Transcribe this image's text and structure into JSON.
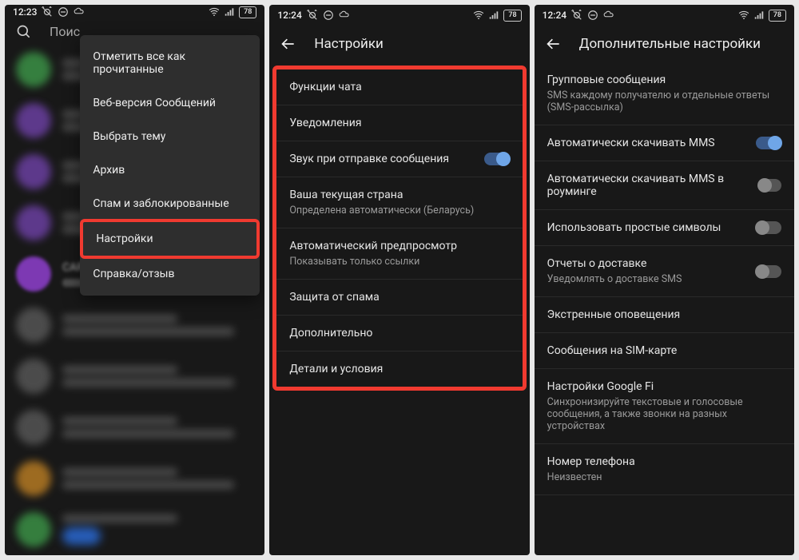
{
  "status": {
    "time1": "12:23",
    "time2": "12:24",
    "time3": "12:24",
    "battery": "78"
  },
  "phone1": {
    "search_placeholder": "Поис",
    "menu": {
      "mark_all_read": "Отметить все как прочитанные",
      "web_version": "Веб-версия Сообщений",
      "choose_theme": "Выбрать тему",
      "archive": "Архив",
      "spam_blocked": "Спам и заблокированные",
      "settings": "Настройки",
      "help_feedback": "Справка/отзыв"
    },
    "chat_label": "CAR"
  },
  "phone2": {
    "title": "Настройки",
    "items": {
      "chat_features": "Функции чата",
      "notifications": "Уведомления",
      "send_sound": "Звук при отправке сообщения",
      "country_title": "Ваша текущая страна",
      "country_sub": "Определена автоматически (Беларусь)",
      "preview_title": "Автоматический предпросмотр",
      "preview_sub": "Показывать только ссылки",
      "spam_protect": "Защита от спама",
      "advanced": "Дополнительно",
      "details": "Детали и условия"
    }
  },
  "phone3": {
    "title": "Дополнительные настройки",
    "group_title": "Групповые сообщения",
    "group_sub": "SMS каждому получателю и отдельные ответы (SMS-рассылка)",
    "auto_mms": "Автоматически скачивать MMS",
    "auto_mms_roam": "Автоматически скачивать MMS в роуминге",
    "simple_chars": "Использовать простые символы",
    "delivery_title": "Отчеты о доставке",
    "delivery_sub": "Уведомлять о доставке SMS",
    "emergency": "Экстренные оповещения",
    "sim_messages": "Сообщения на SIM-карте",
    "googlefi_title": "Настройки Google Fi",
    "googlefi_sub": "Синхронизируйте текстовые и голосовые сообщения, а также звонки на разных устройствах",
    "phone_title": "Номер телефона",
    "phone_sub": "Неизвестен"
  }
}
